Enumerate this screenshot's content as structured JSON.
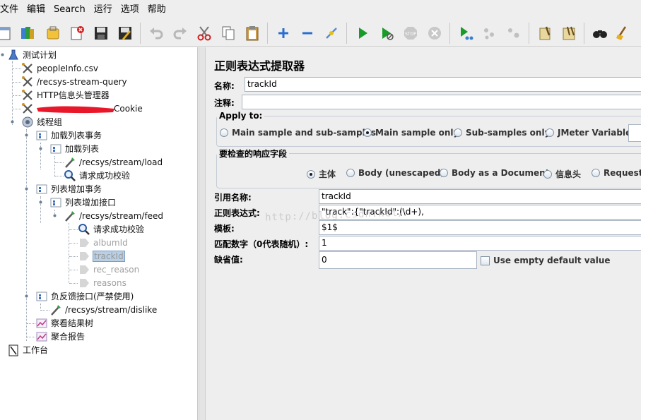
{
  "menu": [
    "文件",
    "编辑",
    "Search",
    "运行",
    "选项",
    "帮助"
  ],
  "toolbar": {
    "icons": [
      "new-icon",
      "templates-icon",
      "open-icon",
      "close-icon",
      "save-icon",
      "save-as-icon",
      "undo-icon",
      "redo-icon",
      "cut-icon",
      "copy-icon",
      "paste-icon",
      "expand-icon",
      "collapse-icon",
      "toggle-icon",
      "start-icon",
      "start-no-pause-icon",
      "stop-icon",
      "shutdown-icon",
      "remote-start-icon",
      "remote-stop-icon",
      "remote-exit-icon",
      "clear-icon",
      "clear-all-icon",
      "search-icon",
      "reset-search-icon"
    ]
  },
  "tree": {
    "nodes": [
      {
        "label": "测试计划",
        "icon": "test-plan-icon"
      },
      {
        "label": "peopleInfo.csv",
        "icon": "config-icon"
      },
      {
        "label": "/recsys-stream-query",
        "icon": "config-icon"
      },
      {
        "label": "HTTP信息头管理器",
        "icon": "config-icon"
      },
      {
        "label": "Cookie",
        "icon": "config-icon"
      },
      {
        "label": "线程组",
        "icon": "thread-group-icon"
      },
      {
        "label": "加载列表事务",
        "icon": "controller-icon"
      },
      {
        "label": "加载列表",
        "icon": "controller-icon"
      },
      {
        "label": "/recsys/stream/load",
        "icon": "sampler-icon"
      },
      {
        "label": "请求成功校验",
        "icon": "assertion-icon"
      },
      {
        "label": "列表增加事务",
        "icon": "controller-icon"
      },
      {
        "label": "列表增加接口",
        "icon": "controller-icon"
      },
      {
        "label": "/recsys/stream/feed",
        "icon": "sampler-icon"
      },
      {
        "label": "请求成功校验",
        "icon": "assertion-icon"
      },
      {
        "label": "albumId",
        "icon": "postprocessor-icon"
      },
      {
        "label": "trackId",
        "icon": "postprocessor-icon"
      },
      {
        "label": "rec_reason",
        "icon": "postprocessor-icon"
      },
      {
        "label": "reasons",
        "icon": "postprocessor-icon"
      },
      {
        "label": "负反馈接口(严禁使用)",
        "icon": "controller-icon"
      },
      {
        "label": "/recsys/stream/dislike",
        "icon": "sampler-icon"
      },
      {
        "label": "察看结果树",
        "icon": "listener-icon"
      },
      {
        "label": "聚合报告",
        "icon": "listener-icon"
      },
      {
        "label": "工作台",
        "icon": "workbench-icon"
      }
    ]
  },
  "panel": {
    "title": "正则表达式提取器",
    "name_label": "名称:",
    "name_value": "trackId",
    "comment_label": "注释:",
    "comment_value": "",
    "apply_to": {
      "title": "Apply to:",
      "options": [
        "Main sample and sub-samples",
        "Main sample only",
        "Sub-samples only",
        "JMeter Variable"
      ],
      "selected": "Main sample only"
    },
    "field_to_check": {
      "title": "要检查的响应字段",
      "options": [
        "主体",
        "Body (unescaped)",
        "Body as a Document",
        "信息头",
        "Request I"
      ],
      "selected": "主体"
    },
    "ref_name_label": "引用名称:",
    "ref_name_value": "trackId",
    "regex_label": "正则表达式:",
    "regex_value": "\"track\":{\"trackId\":(\\d+),",
    "template_label": "模板:",
    "template_value": "$1$",
    "match_no_label": "匹配数字（0代表随机）:",
    "match_no_value": "1",
    "default_label": "缺省值:",
    "default_value": "0",
    "use_empty_default_label": "Use empty default value",
    "watermark": "http://blog.csdn.net/"
  },
  "colors": {
    "selection": "#b8cfe5",
    "redaction": "#e8182a",
    "start_green": "#1a9a2a"
  }
}
